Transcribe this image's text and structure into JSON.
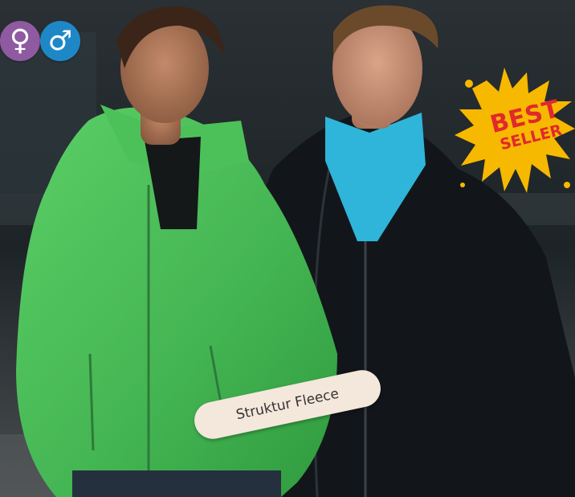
{
  "photo": {
    "description_icons": [
      "female-symbol-icon",
      "male-symbol-icon"
    ],
    "female_symbol": "♀",
    "male_symbol": "♂"
  },
  "badge": {
    "line1": "BEST",
    "line2": "SELLER",
    "color": "#f7b800",
    "text_color": "#e0282e"
  },
  "product_label": {
    "text": "Struktur Fleece"
  },
  "colors": {
    "female_badge": "#8f5aa0",
    "male_badge": "#1e88c7",
    "green_jacket": "#4cbf5a",
    "black_jacket": "#12161a",
    "polo_shirt": "#2fb5d9",
    "pill_background": "#f4e7db"
  }
}
